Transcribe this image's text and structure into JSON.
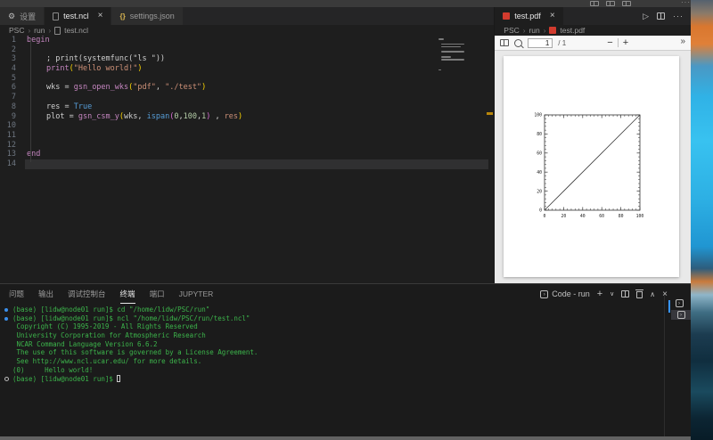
{
  "colors": {
    "terminal_green": "#3cb44b",
    "command_decoration_blue": "#3b8eea",
    "terminal_list_active_bar": "#3794ff",
    "active_tab_bg": "#1e1e1e",
    "pdf_icon_red": "#d23b2e",
    "overview_warning": "#b8860b"
  },
  "editor": {
    "tabs": [
      {
        "label": "设置",
        "active": false
      },
      {
        "label": "test.ncl",
        "active": true,
        "close": "×"
      },
      {
        "label": "settings.json",
        "active": false
      }
    ],
    "breadcrumb": {
      "p0": "PSC",
      "sep": "›",
      "p1": "run",
      "p2": "test.ncl"
    },
    "lines": [
      {
        "n": 1,
        "indent": 0,
        "tokens": [
          {
            "t": "begin",
            "c": "kw"
          }
        ]
      },
      {
        "n": 2,
        "indent": 0,
        "tokens": []
      },
      {
        "n": 3,
        "indent": 1,
        "tokens": [
          {
            "t": "; print(systemfunc(\"ls \"))",
            "c": "plain"
          }
        ]
      },
      {
        "n": 4,
        "indent": 1,
        "tokens": [
          {
            "t": "print",
            "c": "fn"
          },
          {
            "t": "(",
            "c": "br1"
          },
          {
            "t": "\"Hello world!\"",
            "c": "str"
          },
          {
            "t": ")",
            "c": "br1"
          }
        ]
      },
      {
        "n": 5,
        "indent": 0,
        "tokens": []
      },
      {
        "n": 6,
        "indent": 1,
        "tokens": [
          {
            "t": "wks = ",
            "c": "plain"
          },
          {
            "t": "gsn_open_wks",
            "c": "fn"
          },
          {
            "t": "(",
            "c": "br1"
          },
          {
            "t": "\"pdf\"",
            "c": "str"
          },
          {
            "t": ", ",
            "c": "plain"
          },
          {
            "t": "\"./test\"",
            "c": "str"
          },
          {
            "t": ")",
            "c": "br1"
          }
        ]
      },
      {
        "n": 7,
        "indent": 0,
        "tokens": []
      },
      {
        "n": 8,
        "indent": 1,
        "tokens": [
          {
            "t": "res = ",
            "c": "plain"
          },
          {
            "t": "True",
            "c": "const"
          }
        ]
      },
      {
        "n": 9,
        "indent": 1,
        "tokens": [
          {
            "t": "plot = ",
            "c": "plain"
          },
          {
            "t": "gsn_csm_y",
            "c": "fn"
          },
          {
            "t": "(",
            "c": "br1"
          },
          {
            "t": "wks",
            "c": "plain"
          },
          {
            "t": ", ",
            "c": "plain"
          },
          {
            "t": "ispan",
            "c": "const"
          },
          {
            "t": "(",
            "c": "br2"
          },
          {
            "t": "0",
            "c": "num"
          },
          {
            "t": ",",
            "c": "plain"
          },
          {
            "t": "100",
            "c": "num"
          },
          {
            "t": ",",
            "c": "plain"
          },
          {
            "t": "1",
            "c": "num"
          },
          {
            "t": ")",
            "c": "br2"
          },
          {
            "t": " , ",
            "c": "plain"
          },
          {
            "t": "res",
            "c": "str"
          },
          {
            "t": ")",
            "c": "br1"
          }
        ]
      },
      {
        "n": 10,
        "indent": 0,
        "tokens": []
      },
      {
        "n": 11,
        "indent": 0,
        "tokens": []
      },
      {
        "n": 12,
        "indent": 0,
        "tokens": []
      },
      {
        "n": 13,
        "indent": 0,
        "tokens": [
          {
            "t": "end",
            "c": "kw"
          }
        ]
      },
      {
        "n": 14,
        "indent": 0,
        "tokens": [],
        "current": true
      }
    ]
  },
  "pdf": {
    "tab": {
      "label": "test.pdf",
      "close": "×"
    },
    "breadcrumb": {
      "p0": "PSC",
      "sep": "›",
      "p1": "run",
      "p2": "test.pdf"
    },
    "actions": {
      "run": "▷",
      "more": "···"
    },
    "toolbar": {
      "page_value": "1",
      "page_total": "/ 1",
      "zoom_out": "−",
      "zoom_in": "+",
      "overflow": "»"
    }
  },
  "chart_data": {
    "type": "line",
    "title": "",
    "xlabel": "",
    "ylabel": "",
    "xlim": [
      0,
      100
    ],
    "ylim": [
      0,
      100
    ],
    "x_ticks": [
      0,
      20,
      40,
      60,
      80,
      100
    ],
    "y_ticks": [
      0,
      20,
      40,
      60,
      80,
      100
    ],
    "minor_tick_step": 4,
    "grid": false,
    "legend": null,
    "frame": "box-all-sides-inward-ticks",
    "series": [
      {
        "name": "ispan(0,100,1)",
        "points": [
          [
            0,
            0
          ],
          [
            100,
            100
          ]
        ],
        "color": "#3a3a3a"
      }
    ]
  },
  "terminal": {
    "tabs": [
      {
        "label": "问题",
        "active": false
      },
      {
        "label": "输出",
        "active": false
      },
      {
        "label": "调试控制台",
        "active": false
      },
      {
        "label": "终端",
        "active": true
      },
      {
        "label": "端口",
        "active": false
      },
      {
        "label": "JUPYTER",
        "active": false
      }
    ],
    "header": {
      "shell_icon": "›",
      "shell_label": "Code - run"
    },
    "lines": [
      {
        "decoration": "dot",
        "text": "(base) [lidw@node01 run]$ cd \"/home/lidw/PSC/run\""
      },
      {
        "decoration": "dot",
        "text": "(base) [lidw@node01 run]$ ncl \"/home/lidw/PSC/run/test.ncl\""
      },
      {
        "decoration": null,
        "text": " Copyright (C) 1995-2019 - All Rights Reserved"
      },
      {
        "decoration": null,
        "text": " University Corporation for Atmospheric Research"
      },
      {
        "decoration": null,
        "text": " NCAR Command Language Version 6.6.2"
      },
      {
        "decoration": null,
        "text": " The use of this software is governed by a License Agreement."
      },
      {
        "decoration": null,
        "text": " See http://www.ncl.ucar.edu/ for more details."
      },
      {
        "decoration": null,
        "text": "(0)     Hello world!"
      },
      {
        "decoration": "circle",
        "text": "(base) [lidw@node01 run]$ ",
        "cursor": true
      }
    ]
  }
}
